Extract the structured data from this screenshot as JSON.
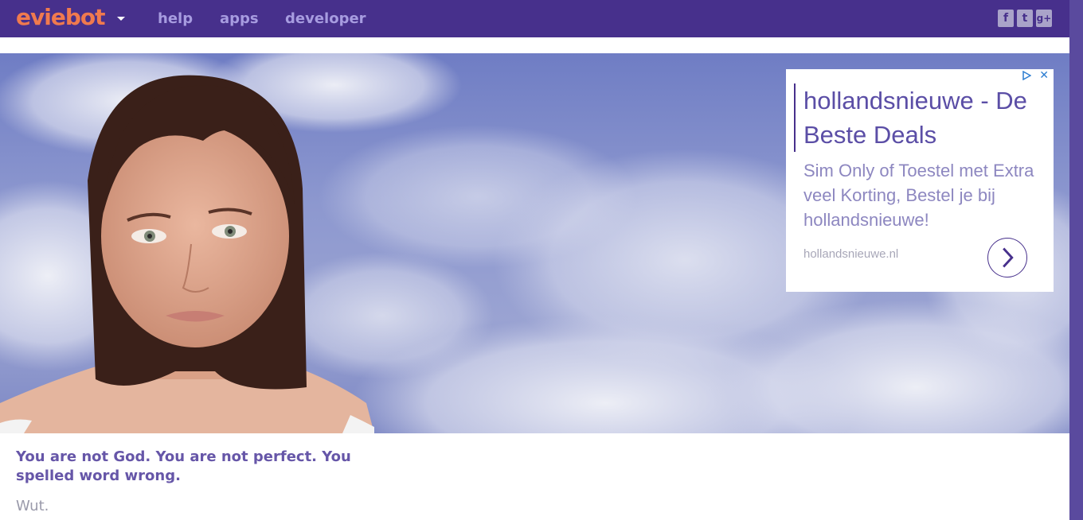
{
  "header": {
    "logo_text": "eviebot",
    "nav": [
      {
        "label": "help"
      },
      {
        "label": "apps"
      },
      {
        "label": "developer"
      }
    ],
    "social": [
      {
        "icon": "facebook-icon",
        "glyph": "f"
      },
      {
        "icon": "twitter-icon",
        "glyph": "t"
      },
      {
        "icon": "google-plus-icon",
        "glyph": "g+"
      }
    ]
  },
  "ad": {
    "title": "hollandsnieuwe - De Beste Deals",
    "body": "Sim Only of Toestel met Extra veel Korting, Bestel je bij hollandsnieuwe!",
    "domain": "hollandsnieuwe.nl",
    "close_glyph": "✕"
  },
  "conversation": {
    "bot_message": "You are not God. You are not perfect. You spelled word wrong.",
    "user_message": "Wut."
  },
  "colors": {
    "nav_bg": "#47308c",
    "logo": "#f07a4e",
    "nav_link": "#a79ce0",
    "bot_text": "#6656a8",
    "user_text": "#9a9aaa"
  }
}
